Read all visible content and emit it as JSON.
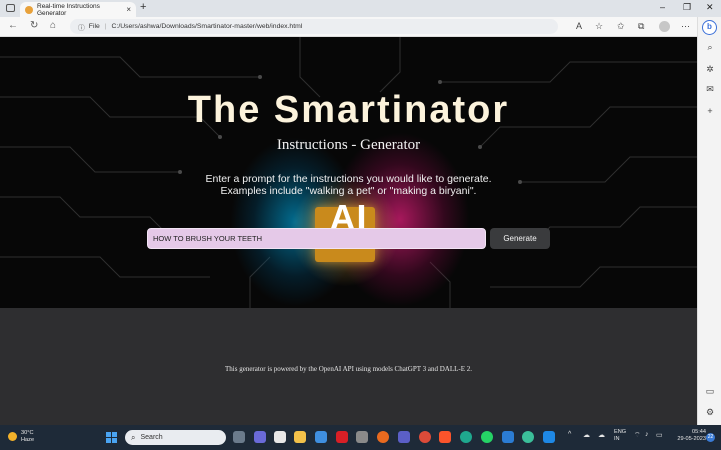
{
  "browser": {
    "tab_title": "Real-time Instructions Generator",
    "tab_close": "×",
    "new_tab": "+",
    "url_scheme_label": "File",
    "url": "C:/Users/ashwa/Downloads/Smartinator-master/web/index.html",
    "window_controls": [
      "–",
      "❐",
      "✕"
    ]
  },
  "page": {
    "title": "The Smartinator",
    "subtitle": "Instructions - Generator",
    "prompt_line1": "Enter a prompt for the instructions you would like to generate.",
    "prompt_line2": "Examples include \"walking a pet\" or \"making a biryani\".",
    "hero_image_text": "AI",
    "input_value": "HOW TO BRUSH YOUR TEETH",
    "generate_label": "Generate",
    "footer": "This generator is powered by the OpenAI API using models ChatGPT 3 and DALL-E 2."
  },
  "taskbar": {
    "weather_temp": "30°C",
    "weather_desc": "Haze",
    "search_label": "Search",
    "lang_line1": "ENG",
    "lang_line2": "IN",
    "time": "05:44",
    "date": "29-05-2023",
    "notification_count": "22"
  },
  "colors": {
    "title": "#fcf3dc",
    "input_bg": "#e5c9e8",
    "button_bg": "#3a3b3d",
    "hero_bg": "#070707",
    "lower_bg": "#2e2e30",
    "taskbar_bg": "#1e2a38"
  }
}
